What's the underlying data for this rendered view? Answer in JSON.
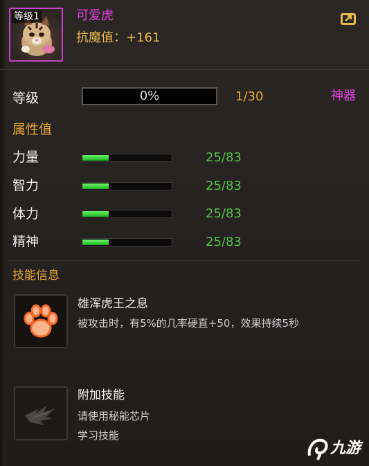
{
  "header": {
    "level_badge": "等级1",
    "pet_name": "可爱虎",
    "stat_text": "抗魔值：+161"
  },
  "level_row": {
    "label": "等级",
    "progress_text": "0%",
    "progress_value": 0,
    "level_value": "1/30",
    "artifact_label": "神器"
  },
  "attributes": {
    "title": "属性值",
    "items": [
      {
        "label": "力量",
        "value": "25/83",
        "fraction": 0.3
      },
      {
        "label": "智力",
        "value": "25/83",
        "fraction": 0.3
      },
      {
        "label": "体力",
        "value": "25/83",
        "fraction": 0.3
      },
      {
        "label": "精神",
        "value": "25/83",
        "fraction": 0.3
      }
    ]
  },
  "skills": {
    "title": "技能信息",
    "items": [
      {
        "name": "雄浑虎王之息",
        "desc": "被攻击时，有5%的几率硬直+50，效果持续5秒",
        "icon": "paw-icon"
      },
      {
        "name": "附加技能",
        "desc_line1": "请使用秘能芯片",
        "desc_line2": "学习技能",
        "icon": "locked-wing-icon"
      }
    ]
  },
  "watermark": {
    "text": "九游"
  },
  "colors": {
    "name_purple": "#e040e0",
    "gold": "#e8a83a",
    "bar_green": "#1fb31f",
    "value_green": "#57c24a"
  }
}
